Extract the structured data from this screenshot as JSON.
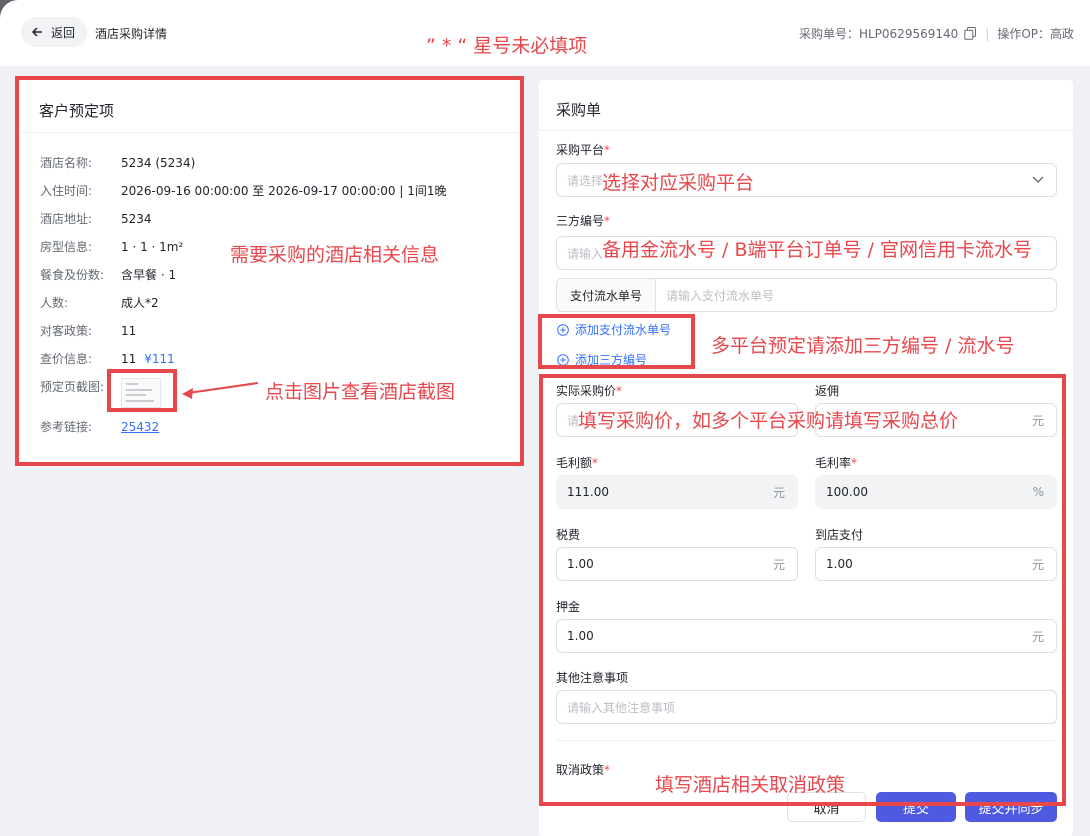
{
  "header": {
    "back_label": "返回",
    "page_title": "酒店采购详情",
    "purchase_no": "采购单号：HLP0629569140",
    "operator": "操作OP：高政"
  },
  "left": {
    "title": "客户预定项",
    "rows": [
      {
        "k": "酒店名称:",
        "v": "5234 (5234)"
      },
      {
        "k": "入住时间:",
        "v": "2026-09-16 00:00:00 至 2026-09-17 00:00:00 | 1间1晚"
      },
      {
        "k": "酒店地址:",
        "v": "5234"
      },
      {
        "k": "房型信息:",
        "v": "1 · 1 · 1m²"
      },
      {
        "k": "餐食及份数:",
        "v": "含早餐 · 1"
      },
      {
        "k": "人数:",
        "v": "成人*2"
      },
      {
        "k": "对客政策:",
        "v": "11"
      },
      {
        "k": "查价信息:",
        "v": "11",
        "price": "¥111"
      },
      {
        "k": "预定页截图:"
      },
      {
        "k": "参考链接:",
        "link": "25432"
      }
    ]
  },
  "right": {
    "title": "采购单",
    "platform": {
      "label": "采购平台",
      "placeholder": "请选择"
    },
    "third_no": {
      "label": "三方编号",
      "placeholder": "请输入"
    },
    "pay_no": {
      "prefix": "支付流水单号",
      "placeholder": "请输入支付流水单号"
    },
    "add_pay": "添加支付流水单号",
    "add_third": "添加三方编号",
    "actual_price": {
      "label": "实际采购价",
      "placeholder": "请"
    },
    "rebate": {
      "label": "返佣",
      "unit": "元"
    },
    "gross_profit": {
      "label": "毛利额",
      "value": "111.00",
      "unit": "元"
    },
    "gross_rate": {
      "label": "毛利率",
      "value": "100.00",
      "unit": "%"
    },
    "tax": {
      "label": "税费",
      "value": "1.00",
      "unit": "元"
    },
    "pay_at_hotel": {
      "label": "到店支付",
      "value": "1.00",
      "unit": "元"
    },
    "deposit": {
      "label": "押金",
      "value": "1.00",
      "unit": "元"
    },
    "other": {
      "label": "其他注意事项",
      "placeholder": "请输入其他注意事项"
    },
    "cancel_policy": {
      "label": "取消政策"
    },
    "buttons": {
      "cancel": "取消",
      "submit": "提交",
      "submit_sync": "提交并同步"
    }
  },
  "annotations": {
    "required_note": "” * “ 星号未必填项",
    "hotel_info": "需要采购的酒店相关信息",
    "screenshot_click": "点击图片查看酒店截图",
    "platform_select": "选择对应采购平台",
    "third_no_hint": "备用金流水号 / B端平台订单号 / 官网信用卡流水号",
    "multi_platform": "多平台预定请添加三方编号 / 流水号",
    "price_fill": "填写采购价，如多个平台采购请填写采购总价",
    "cancel_fill": "填写酒店相关取消政策"
  },
  "colors": {
    "accent": "#3370ff",
    "annotation": "#e8474c",
    "primary_button": "#4e5ae0"
  }
}
